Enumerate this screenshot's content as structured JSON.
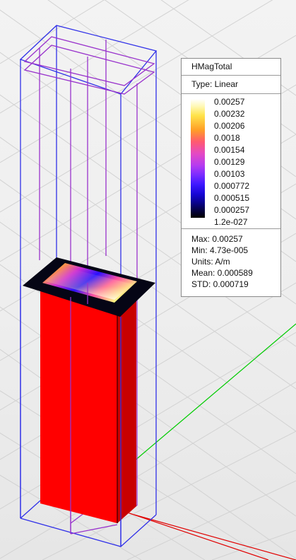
{
  "plot": {
    "title": "HMagTotal",
    "type_label": "Type: Linear",
    "scale_ticks": [
      "0.00257",
      "0.00232",
      "0.00206",
      "0.0018",
      "0.00154",
      "0.00129",
      "0.00103",
      "0.000772",
      "0.000515",
      "0.000257",
      "1.2e-027"
    ],
    "stats": {
      "max": "Max: 0.00257",
      "min": "Min: 4.73e-005",
      "units": "Units: A/m",
      "mean": "Mean: 0.000589",
      "std": "STD: 0.000719"
    }
  },
  "colors": {
    "outer_box_wireframe": "#2f2fe8",
    "inner_wireframe": "#9933cc",
    "conductor": "#ff0000",
    "axis_x": "#e00000",
    "axis_y": "#00cc00",
    "grid": "#cfcfcf"
  }
}
